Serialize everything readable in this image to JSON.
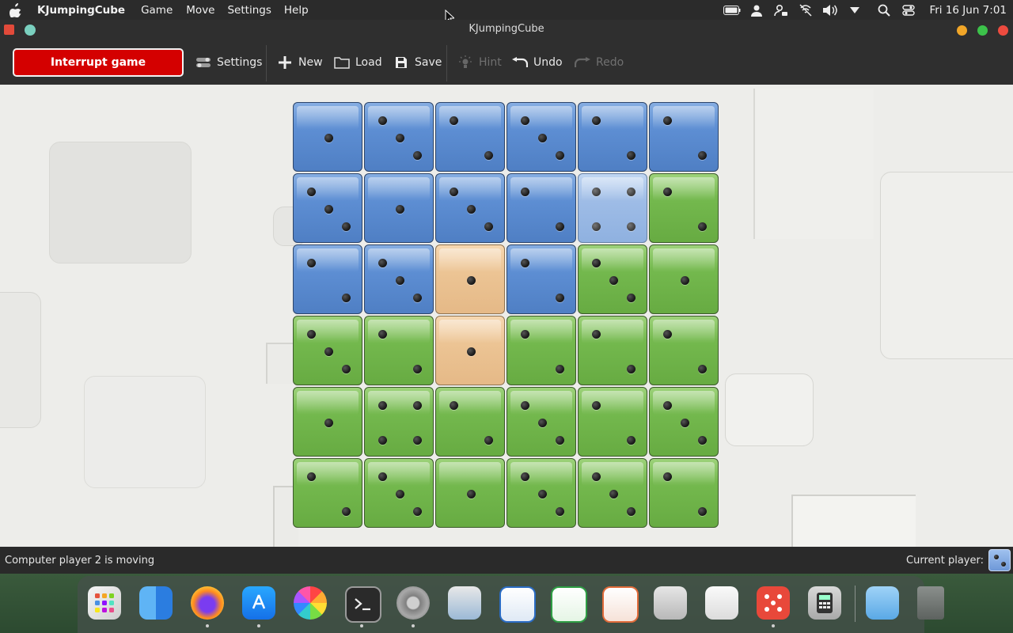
{
  "menubar": {
    "app_name": "KJumpingCube",
    "menus": [
      "Game",
      "Move",
      "Settings",
      "Help"
    ],
    "clock": "Fri 16 Jun  7:01",
    "status_icons": [
      "battery-icon",
      "user-icon",
      "user-switch-icon",
      "notifications-muted-icon",
      "volume-icon",
      "dropdown-icon",
      "search-icon",
      "control-center-icon"
    ]
  },
  "window": {
    "title": "KJumpingCube"
  },
  "toolbar": {
    "interrupt_label": "Interrupt game",
    "settings_label": "Settings",
    "new_label": "New",
    "load_label": "Load",
    "save_label": "Save",
    "hint_label": "Hint",
    "undo_label": "Undo",
    "redo_label": "Redo"
  },
  "colors": {
    "player1": "#5e8fd4",
    "player2": "#74b94e",
    "neutral": "#ecc494",
    "highlight": "#9ebce6",
    "interrupt": "#d40000"
  },
  "board": {
    "size": 6,
    "cells": [
      [
        {
          "owner": "blue",
          "value": 1
        },
        {
          "owner": "blue",
          "value": 3
        },
        {
          "owner": "blue",
          "value": 2
        },
        {
          "owner": "blue",
          "value": 3
        },
        {
          "owner": "blue",
          "value": 2
        },
        {
          "owner": "blue",
          "value": 2
        }
      ],
      [
        {
          "owner": "blue",
          "value": 3
        },
        {
          "owner": "blue",
          "value": 1
        },
        {
          "owner": "blue",
          "value": 3
        },
        {
          "owner": "blue",
          "value": 2
        },
        {
          "owner": "lightblue",
          "value": 4
        },
        {
          "owner": "green",
          "value": 2
        }
      ],
      [
        {
          "owner": "blue",
          "value": 2
        },
        {
          "owner": "blue",
          "value": 3
        },
        {
          "owner": "orange",
          "value": 1
        },
        {
          "owner": "blue",
          "value": 2
        },
        {
          "owner": "green",
          "value": 3
        },
        {
          "owner": "green",
          "value": 1
        }
      ],
      [
        {
          "owner": "green",
          "value": 3
        },
        {
          "owner": "green",
          "value": 2
        },
        {
          "owner": "orange",
          "value": 1
        },
        {
          "owner": "green",
          "value": 2
        },
        {
          "owner": "green",
          "value": 2
        },
        {
          "owner": "green",
          "value": 2
        }
      ],
      [
        {
          "owner": "green",
          "value": 1
        },
        {
          "owner": "green",
          "value": 4
        },
        {
          "owner": "green",
          "value": 2
        },
        {
          "owner": "green",
          "value": 3
        },
        {
          "owner": "green",
          "value": 2
        },
        {
          "owner": "green",
          "value": 3
        }
      ],
      [
        {
          "owner": "green",
          "value": 2
        },
        {
          "owner": "green",
          "value": 3
        },
        {
          "owner": "green",
          "value": 1
        },
        {
          "owner": "green",
          "value": 3
        },
        {
          "owner": "green",
          "value": 3
        },
        {
          "owner": "green",
          "value": 2
        }
      ]
    ]
  },
  "statusbar": {
    "message": "Computer player 2 is moving",
    "current_player_label": "Current player:",
    "current_player_value": 1
  },
  "dock": {
    "apps": [
      {
        "name": "launchpad-icon",
        "running": false
      },
      {
        "name": "finder-icon",
        "running": false
      },
      {
        "name": "firefox-icon",
        "running": true
      },
      {
        "name": "app-store-icon",
        "running": true
      },
      {
        "name": "photos-icon",
        "running": false
      },
      {
        "name": "terminal-icon",
        "running": true
      },
      {
        "name": "system-settings-icon",
        "running": true
      },
      {
        "name": "preview-icon",
        "running": false
      },
      {
        "name": "writer-icon",
        "running": false
      },
      {
        "name": "spreadsheet-icon",
        "running": false
      },
      {
        "name": "drawing-icon",
        "running": false
      },
      {
        "name": "media-player-icon",
        "running": false
      },
      {
        "name": "text-editor-icon",
        "running": false
      },
      {
        "name": "kjumpingcube-icon",
        "running": true
      },
      {
        "name": "calculator-icon",
        "running": false
      },
      {
        "name": "downloads-folder-icon",
        "running": false
      },
      {
        "name": "trash-icon",
        "running": false
      }
    ]
  }
}
